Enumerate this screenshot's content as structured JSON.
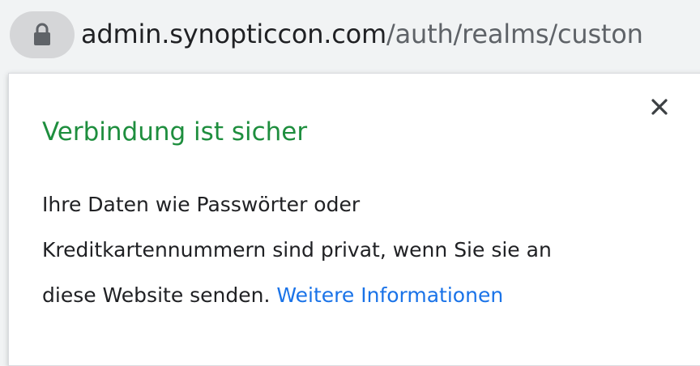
{
  "address_bar": {
    "lock_icon": "lock-icon",
    "url_host": "admin.synopticcon.com",
    "url_path": "/auth/realms/custon"
  },
  "security_popup": {
    "close_icon": "close-icon",
    "title": "Verbindung ist sicher",
    "description_line1": "Ihre Daten wie Passwörter oder",
    "description_line2": "Kreditkartennummern sind privat, wenn Sie sie an",
    "description_line3": "diese Website senden.",
    "learn_more_link": "Weitere Informationen"
  },
  "colors": {
    "secure_green": "#1e8e3e",
    "link_blue": "#1a73e8",
    "url_host": "#202124",
    "url_path": "#5f6368"
  }
}
